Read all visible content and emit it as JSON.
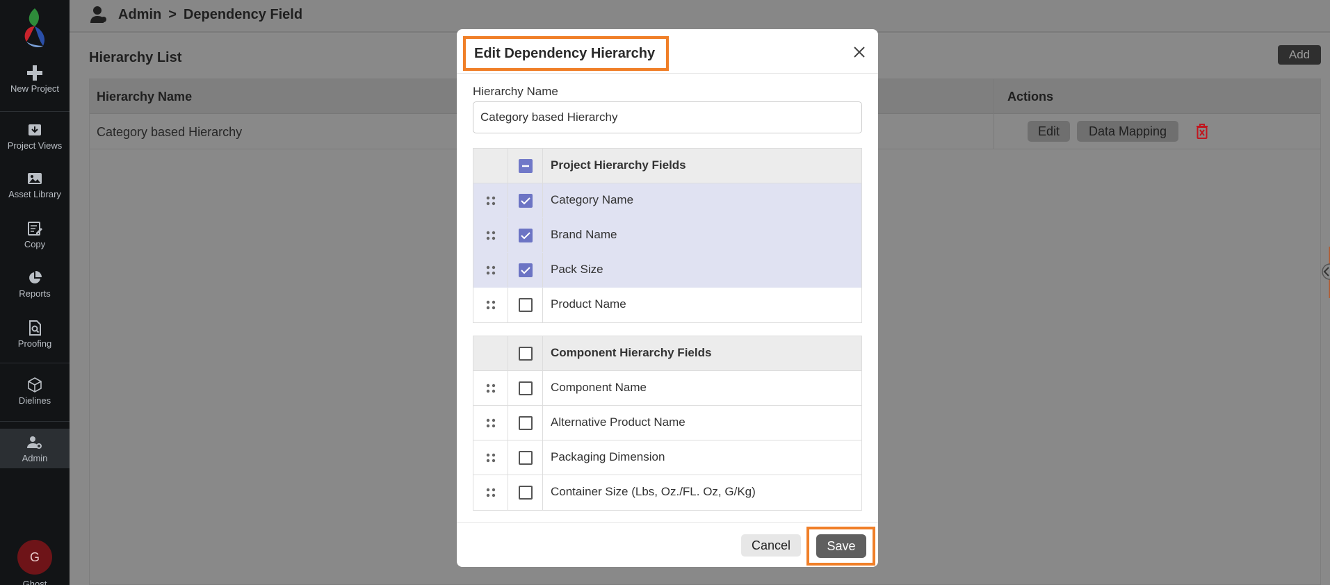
{
  "sidebar": {
    "items": [
      {
        "label": "New Project",
        "icon": "plus-icon"
      },
      {
        "label": "Project Views",
        "icon": "download-box-icon"
      },
      {
        "label": "Asset Library",
        "icon": "image-icon"
      },
      {
        "label": "Copy",
        "icon": "edit-note-icon"
      },
      {
        "label": "Reports",
        "icon": "pie-chart-icon"
      },
      {
        "label": "Proofing",
        "icon": "document-search-icon"
      },
      {
        "label": "Dielines",
        "icon": "cube-icon"
      },
      {
        "label": "Admin",
        "icon": "user-gear-icon"
      }
    ],
    "avatar_initial": "G",
    "avatar_name": "Ghost"
  },
  "header": {
    "crumb_root": "Admin",
    "crumb_sep": ">",
    "crumb_current": "Dependency Field"
  },
  "main": {
    "list_title": "Hierarchy List",
    "add_label": "Add",
    "table": {
      "col_name": "Hierarchy Name",
      "col_actions": "Actions",
      "rows": [
        {
          "name": "Category based Hierarchy",
          "edit_label": "Edit",
          "mapping_label": "Data Mapping"
        }
      ]
    }
  },
  "modal": {
    "title": "Edit Dependency Hierarchy",
    "field_label": "Hierarchy Name",
    "field_value": "Category based Hierarchy",
    "project_group": {
      "header": "Project Hierarchy Fields",
      "state": "indeterminate",
      "fields": [
        {
          "label": "Category Name",
          "checked": true
        },
        {
          "label": "Brand Name",
          "checked": true
        },
        {
          "label": "Pack Size",
          "checked": true
        },
        {
          "label": "Product Name",
          "checked": false
        }
      ]
    },
    "component_group": {
      "header": "Component Hierarchy Fields",
      "state": "unchecked",
      "fields": [
        {
          "label": "Component Name",
          "checked": false
        },
        {
          "label": "Alternative Product Name",
          "checked": false
        },
        {
          "label": "Packaging Dimension",
          "checked": false
        },
        {
          "label": "Container Size (Lbs, Oz./FL. Oz, G/Kg)",
          "checked": false
        }
      ]
    },
    "cancel_label": "Cancel",
    "save_label": "Save"
  },
  "colors": {
    "highlight": "#f07f28",
    "checkbox_accent": "#6c74c4",
    "selected_row": "#e0e2f2",
    "delete_icon": "#c0161f"
  }
}
